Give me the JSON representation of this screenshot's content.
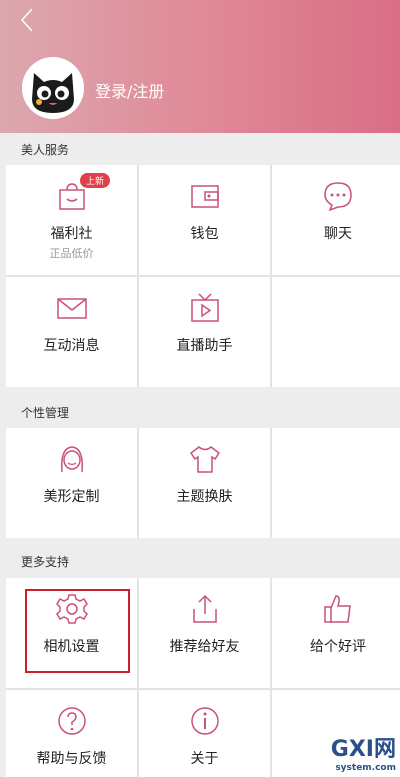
{
  "header": {
    "login_label": "登录/注册"
  },
  "sections": {
    "beauty_service": {
      "title": "美人服务",
      "items": [
        {
          "label": "福利社",
          "sublabel": "正品低价",
          "badge": "上新",
          "icon": "bag-icon"
        },
        {
          "label": "钱包",
          "icon": "wallet-icon"
        },
        {
          "label": "聊天",
          "icon": "chat-icon"
        },
        {
          "label": "互动消息",
          "icon": "envelope-icon"
        },
        {
          "label": "直播助手",
          "icon": "tv-play-icon"
        }
      ]
    },
    "personal": {
      "title": "个性管理",
      "items": [
        {
          "label": "美形定制",
          "icon": "face-icon"
        },
        {
          "label": "主题换肤",
          "icon": "shirt-icon"
        }
      ]
    },
    "more": {
      "title": "更多支持",
      "items": [
        {
          "label": "相机设置",
          "icon": "gear-icon"
        },
        {
          "label": "推荐给好友",
          "icon": "share-icon"
        },
        {
          "label": "给个好评",
          "icon": "thumbs-up-icon"
        },
        {
          "label": "帮助与反馈",
          "icon": "help-icon"
        },
        {
          "label": "关于",
          "icon": "info-icon"
        }
      ]
    }
  },
  "watermark": {
    "main": "GXI网",
    "sub": "system.com"
  },
  "colors": {
    "icon": "#c9527a",
    "highlight": "#c8212b",
    "badge": "#e0404a"
  }
}
